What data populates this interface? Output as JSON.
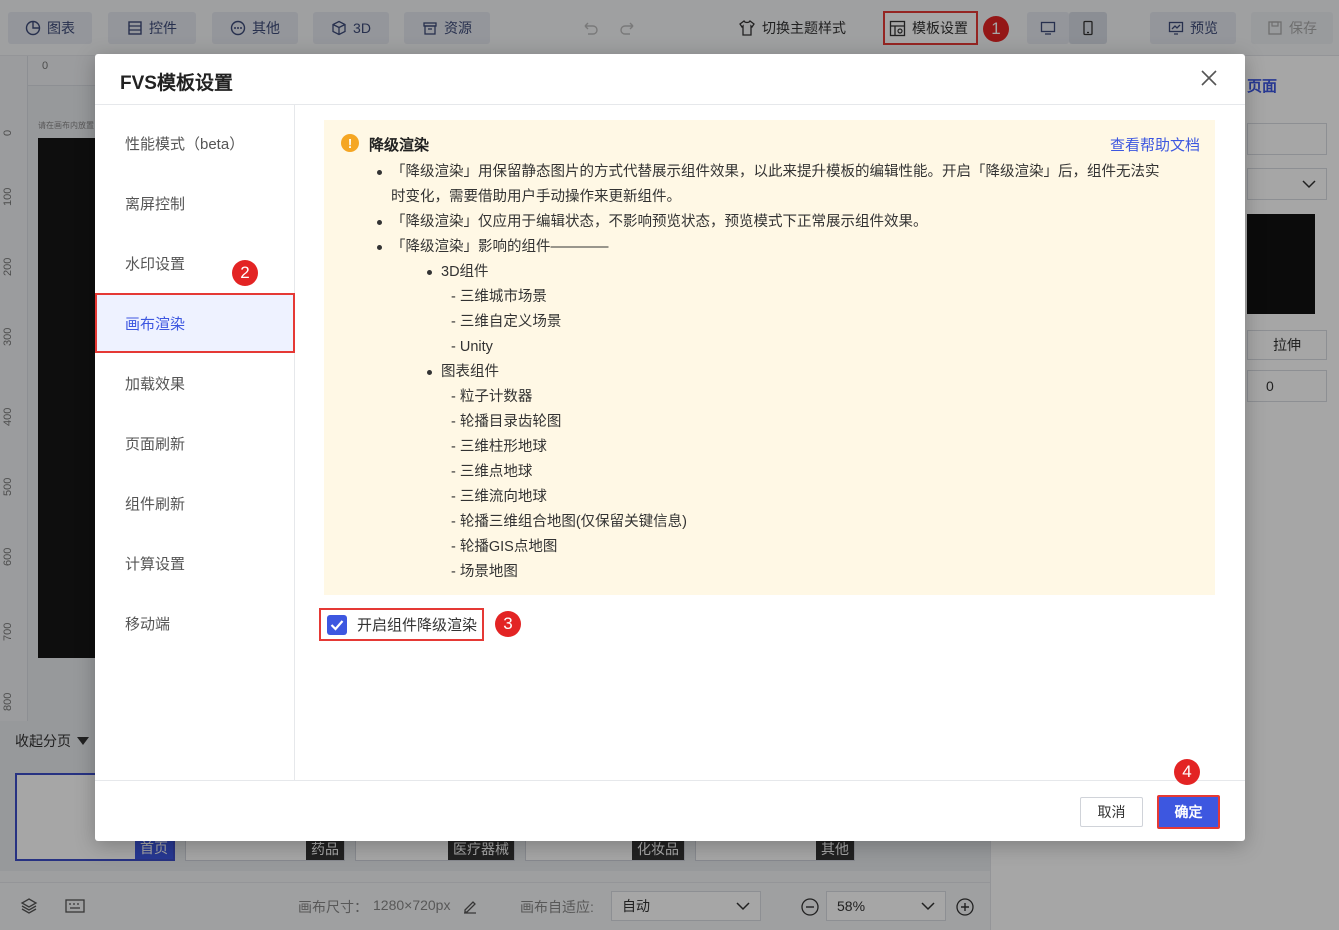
{
  "toolbar": {
    "chart": "图表",
    "widget": "控件",
    "other": "其他",
    "threeD": "3D",
    "resource": "资源",
    "theme_switch": "切换主题样式",
    "template_settings": "模板设置",
    "preview": "预览",
    "save": "保存"
  },
  "badges": {
    "b1": "1",
    "b2": "2",
    "b3": "3",
    "b4": "4"
  },
  "ruler": {
    "top_zero": "0",
    "left_marks": [
      "0",
      "100",
      "200",
      "300",
      "400",
      "500",
      "600",
      "700",
      "800"
    ]
  },
  "canvas": {
    "hint": "请在画布内放置"
  },
  "right_panel": {
    "tab_label": "页面",
    "stretch_label": "拉伸",
    "value": "0"
  },
  "pages": {
    "collapse_label": "收起分页",
    "thumbs": [
      "首页",
      "药品",
      "医疗器械",
      "化妆品",
      "其他"
    ]
  },
  "bottom": {
    "canvas_size_label": "画布尺寸：",
    "canvas_size_value": "1280×720px",
    "adapt_label": "画布自适应:",
    "adapt_value": "自动",
    "zoom_value": "58%"
  },
  "modal": {
    "title": "FVS模板设置",
    "side_items": [
      "性能模式（beta）",
      "离屏控制",
      "水印设置",
      "画布渲染",
      "加载效果",
      "页面刷新",
      "组件刷新",
      "计算设置",
      "移动端"
    ],
    "active_index": 3,
    "notice": {
      "title": "降级渲染",
      "help_link": "查看帮助文档",
      "bullet1_line1": "「降级渲染」用保留静态图片的方式代替展示组件效果，以此来提升模板的编辑性能。开启「降级渲染」后，组件无法实",
      "bullet1_line2": "时变化，需要借助用户手动操作来更新组件。",
      "bullet2": "「降级渲染」仅应用于编辑状态，不影响预览状态，预览模式下正常展示组件效果。",
      "bullet3": "「降级渲染」影响的组件————",
      "group1": "3D组件",
      "group1_items": [
        "三维城市场景",
        "三维自定义场景",
        "Unity"
      ],
      "group2": "图表组件",
      "group2_items": [
        "粒子计数器",
        "轮播目录齿轮图",
        "三维柱形地球",
        "三维点地球",
        "三维流向地球",
        "轮播三维组合地图(仅保留关键信息)",
        "轮播GIS点地图",
        "场景地图"
      ]
    },
    "checkbox_label": "开启组件降级渲染",
    "checkbox_checked": true,
    "cancel": "取消",
    "ok": "确定"
  }
}
